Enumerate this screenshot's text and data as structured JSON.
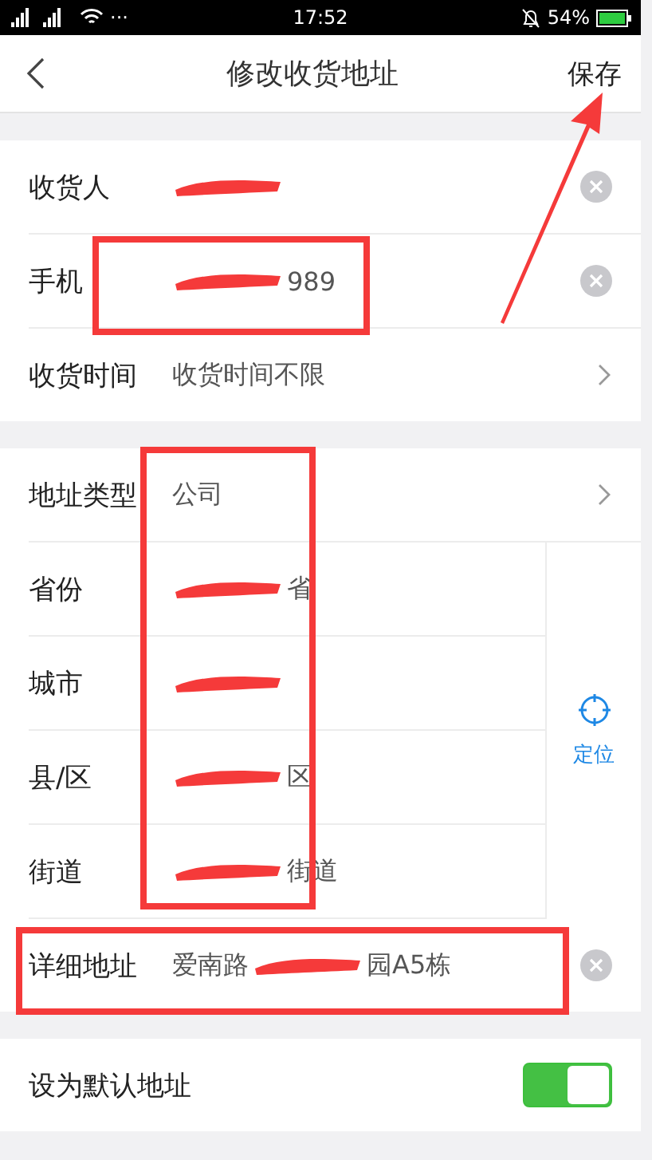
{
  "status_bar": {
    "dots": "···",
    "time": "17:52",
    "battery": "54%"
  },
  "header": {
    "title": "修改收货地址",
    "save": "保存"
  },
  "contact_rows": [
    {
      "label": "收货人",
      "trailing": {
        "kind": "clear"
      },
      "value": [
        {
          "kind": "redaction"
        }
      ]
    },
    {
      "label": "手机",
      "trailing": {
        "kind": "clear"
      },
      "value": [
        {
          "kind": "redaction"
        },
        {
          "kind": "text",
          "text": "989"
        }
      ]
    },
    {
      "label": "收货时间",
      "trailing": {
        "kind": "chevron"
      },
      "value": [
        {
          "kind": "text",
          "text": "收货时间不限"
        }
      ]
    }
  ],
  "address_type": {
    "label": "地址类型",
    "trailing": {
      "kind": "chevron"
    },
    "value": [
      {
        "kind": "text",
        "text": "公司"
      }
    ]
  },
  "region_rows": [
    {
      "label": "省份",
      "value": [
        {
          "kind": "redaction"
        },
        {
          "kind": "text",
          "text": "省"
        }
      ]
    },
    {
      "label": "城市",
      "value": [
        {
          "kind": "redaction"
        }
      ]
    },
    {
      "label": "县/区",
      "value": [
        {
          "kind": "redaction"
        },
        {
          "kind": "text",
          "text": "区"
        }
      ]
    },
    {
      "label": "街道",
      "value": [
        {
          "kind": "redaction"
        },
        {
          "kind": "text",
          "text": "街道"
        }
      ]
    }
  ],
  "locate": {
    "label": "定位"
  },
  "detail_row": {
    "label": "详细地址",
    "trailing": {
      "kind": "clear"
    },
    "value": [
      {
        "kind": "text",
        "text": "爱南路"
      },
      {
        "kind": "redaction"
      },
      {
        "kind": "text",
        "text": "园A5栋"
      }
    ]
  },
  "default_row": {
    "label": "设为默认地址",
    "on": true
  }
}
